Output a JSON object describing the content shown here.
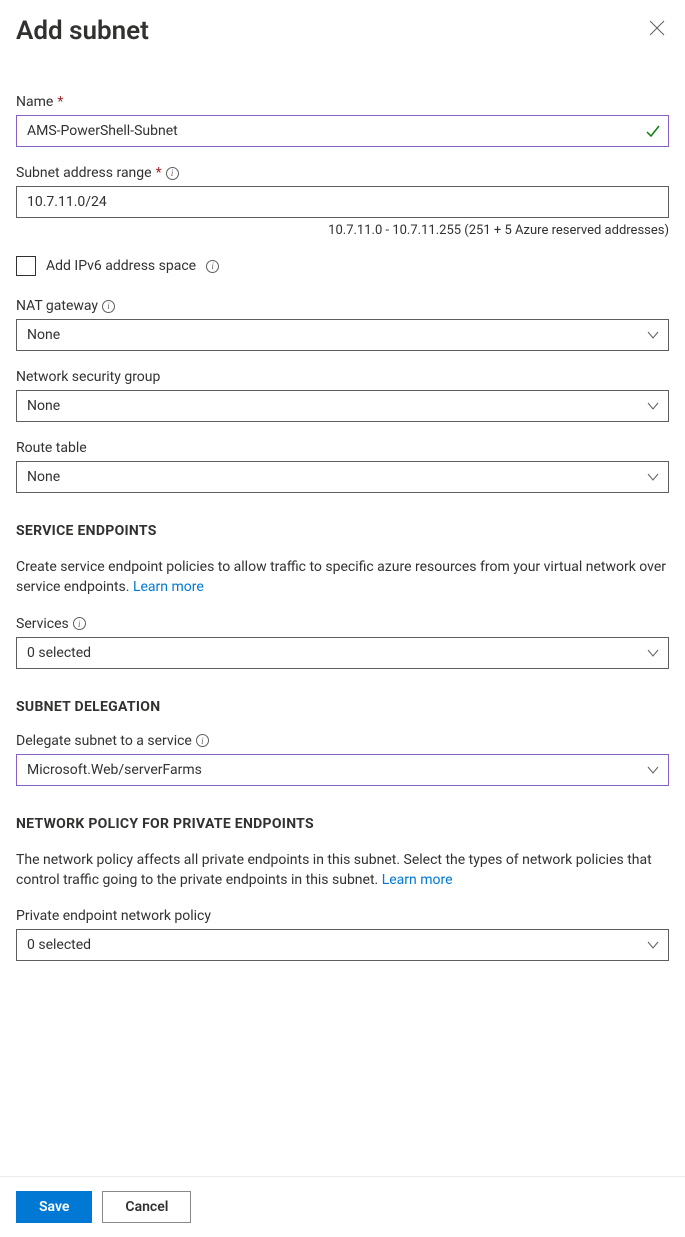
{
  "header": {
    "title": "Add subnet"
  },
  "fields": {
    "name": {
      "label": "Name",
      "value": "AMS-PowerShell-Subnet"
    },
    "subnet_range": {
      "label": "Subnet address range",
      "value": "10.7.11.0/24",
      "hint": "10.7.11.0 - 10.7.11.255 (251 + 5 Azure reserved addresses)"
    },
    "ipv6": {
      "label": "Add IPv6 address space"
    },
    "nat": {
      "label": "NAT gateway",
      "value": "None"
    },
    "nsg": {
      "label": "Network security group",
      "value": "None"
    },
    "route": {
      "label": "Route table",
      "value": "None"
    }
  },
  "service_endpoints": {
    "header": "SERVICE ENDPOINTS",
    "desc": "Create service endpoint policies to allow traffic to specific azure resources from your virtual network over service endpoints. ",
    "learn_more": "Learn more",
    "services_label": "Services",
    "services_value": "0 selected"
  },
  "delegation": {
    "header": "SUBNET DELEGATION",
    "label": "Delegate subnet to a service",
    "value": "Microsoft.Web/serverFarms"
  },
  "network_policy": {
    "header": "NETWORK POLICY FOR PRIVATE ENDPOINTS",
    "desc": "The network policy affects all private endpoints in this subnet. Select the types of network policies that control traffic going to the private endpoints in this subnet. ",
    "learn_more": "Learn more",
    "label": "Private endpoint network policy",
    "value": "0 selected"
  },
  "footer": {
    "save": "Save",
    "cancel": "Cancel"
  }
}
